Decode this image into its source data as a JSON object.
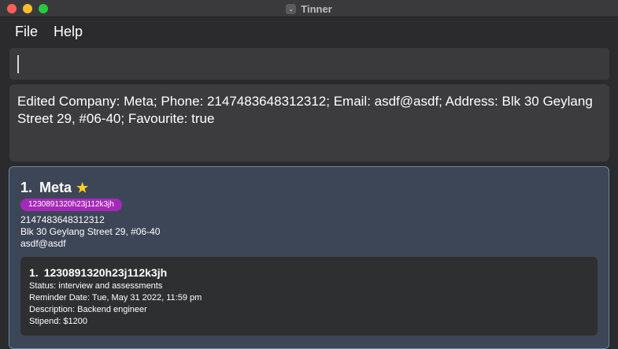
{
  "window": {
    "title": "Tinner",
    "app_icon": "chevron-icon"
  },
  "menu": {
    "items": [
      "File",
      "Help"
    ]
  },
  "command_box": {
    "value": ""
  },
  "result_display": {
    "text": "Edited Company: Meta; Phone: 2147483648312312; Email: asdf@asdf; Address: Blk 30 Geylang Street 29, #06-40; Favourite: true"
  },
  "companies": [
    {
      "index": "1.",
      "name": "Meta",
      "favourite_icon": "star-icon",
      "tags": [
        "1230891320h23j112k3jh"
      ],
      "phone": "2147483648312312",
      "address": "Blk 30 Geylang Street 29, #06-40",
      "email": "asdf@asdf",
      "internships": [
        {
          "index": "1.",
          "role": "1230891320h23j112k3jh",
          "status": "Status: interview and assessments",
          "reminder": "Reminder Date: Tue, May 31 2022, 11:59 pm",
          "description": "Description: Backend engineer",
          "stipend": "Stipend: $1200"
        }
      ]
    }
  ],
  "colors": {
    "background": "#2b2b2d",
    "card": "#3d4656",
    "tag": "#a628b9",
    "star": "#ffd21f"
  }
}
